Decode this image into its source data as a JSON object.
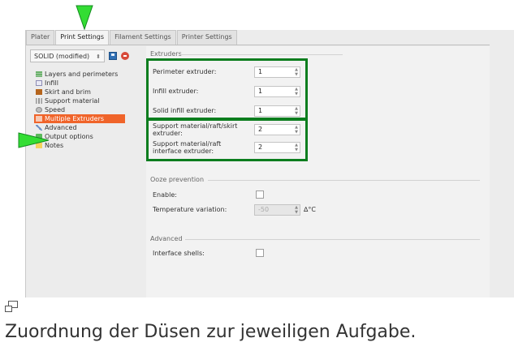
{
  "tabs": [
    {
      "label": "Plater"
    },
    {
      "label": "Print Settings"
    },
    {
      "label": "Filament Settings"
    },
    {
      "label": "Printer Settings"
    }
  ],
  "preset": {
    "value": "SOLID (modified)"
  },
  "tree": [
    {
      "label": "Layers and perimeters",
      "icon": "layers-icon"
    },
    {
      "label": "Infill",
      "icon": "infill-icon"
    },
    {
      "label": "Skirt and brim",
      "icon": "skirt-icon"
    },
    {
      "label": "Support material",
      "icon": "support-icon"
    },
    {
      "label": "Speed",
      "icon": "speed-icon"
    },
    {
      "label": "Multiple Extruders",
      "icon": "extruder-icon"
    },
    {
      "label": "Advanced",
      "icon": "wrench-icon"
    },
    {
      "label": "Output options",
      "icon": "output-icon"
    },
    {
      "label": "Notes",
      "icon": "notes-icon"
    }
  ],
  "extruders": {
    "title": "Extruders",
    "perimeter": {
      "label": "Perimeter extruder:",
      "value": "1"
    },
    "infill": {
      "label": "Infill extruder:",
      "value": "1"
    },
    "solid_infill": {
      "label": "Solid infill extruder:",
      "value": "1"
    },
    "support": {
      "label": "Support material/raft/skirt extruder:",
      "value": "2"
    },
    "support_interface": {
      "label": "Support material/raft interface extruder:",
      "value": "2"
    }
  },
  "ooze": {
    "title": "Ooze prevention",
    "enable_label": "Enable:",
    "temp_label": "Temperature variation:",
    "temp_value": "-50",
    "temp_unit": "∆°C"
  },
  "advanced": {
    "title": "Advanced",
    "interface_shells_label": "Interface shells:"
  },
  "caption": "Zuordnung der Düsen zur jeweiligen Aufgabe.",
  "colors": {
    "highlight": "#0b7d1e",
    "arrow": "#33dd33",
    "selected": "#f0642a"
  }
}
